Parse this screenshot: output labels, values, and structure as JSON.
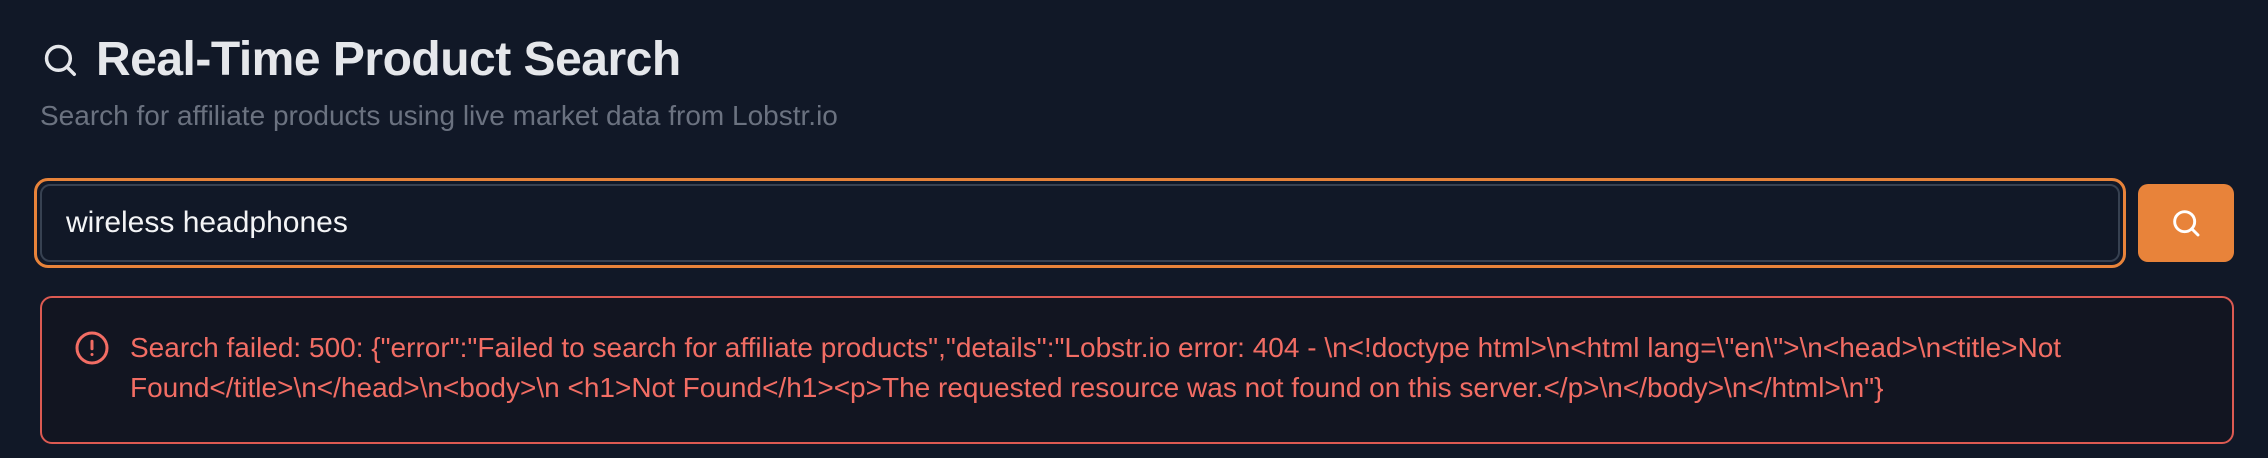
{
  "header": {
    "icon": "search-icon",
    "title": "Real-Time Product Search",
    "subtitle": "Search for affiliate products using live market data from Lobstr.io"
  },
  "search": {
    "value": "wireless headphones",
    "placeholder": "",
    "button_icon": "search-icon"
  },
  "error": {
    "icon": "alert-circle-icon",
    "message": "Search failed: 500: {\"error\":\"Failed to search for affiliate products\",\"details\":\"Lobstr.io error: 404 - \\n<!doctype html>\\n<html lang=\\\"en\\\">\\n<head>\\n<title>Not Found</title>\\n</head>\\n<body>\\n <h1>Not Found</h1><p>The requested resource was not found on this server.</p>\\n</body>\\n</html>\\n\"}"
  },
  "colors": {
    "background": "#111827",
    "accent": "#e8833a",
    "error": "#f26d64",
    "muted": "#6b7280"
  }
}
